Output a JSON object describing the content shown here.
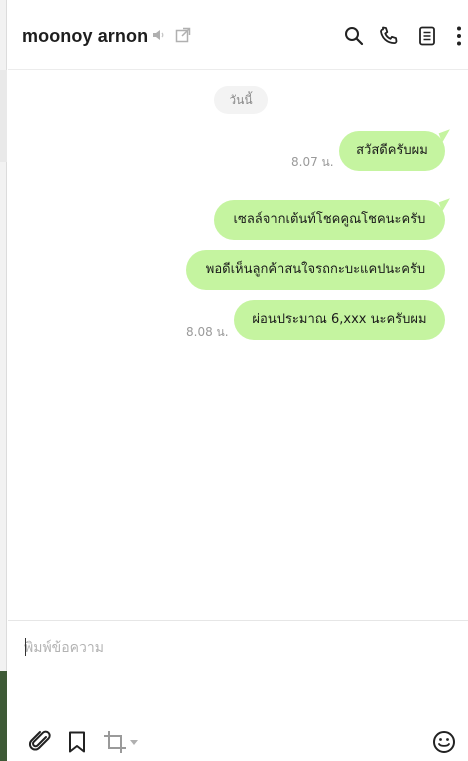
{
  "header": {
    "title": "moonoy arnon",
    "icons": [
      "mute-icon",
      "external-window-icon",
      "search-icon",
      "phone-icon",
      "notes-icon",
      "more-icon"
    ]
  },
  "chat": {
    "date_chip": "วันนี้",
    "messages": [
      {
        "text": "สวัสดีครับผม",
        "time": "8.07 น."
      },
      {
        "text": "เซลล์จากเต้นท์โชคคูณโชคนะครับ",
        "time": ""
      },
      {
        "text": "พอดีเห็นลูกค้าสนใจรถกะบะแคปนะครับ",
        "time": ""
      },
      {
        "text": "ผ่อนประมาณ 6,xxx นะครับผม",
        "time": "8.08 น."
      }
    ],
    "bubble_color": "#c5f4a0"
  },
  "composer": {
    "placeholder": "พิมพ์ข้อความ",
    "value": "",
    "tools": [
      "attach-icon",
      "bookmark-icon",
      "crop-icon",
      "emoji-icon"
    ]
  }
}
